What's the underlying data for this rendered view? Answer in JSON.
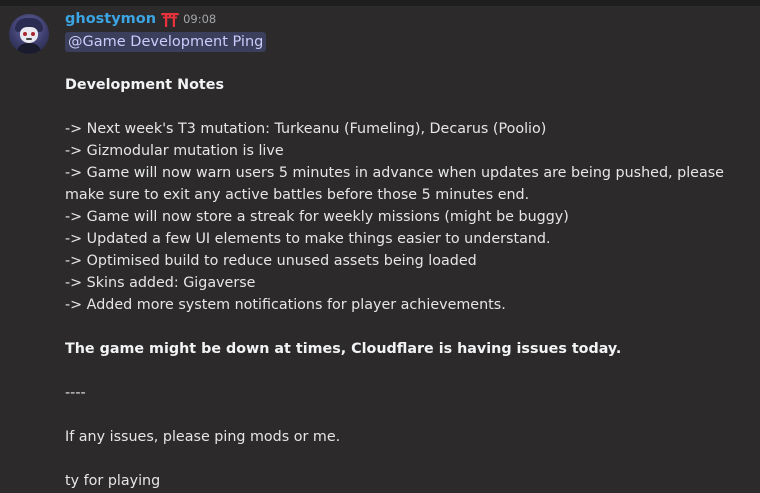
{
  "message": {
    "author": "ghostymon",
    "role_icon": "torii-gate-icon",
    "timestamp": "09:08",
    "mention": "@Game Development Ping",
    "heading": "Development Notes",
    "notes": [
      "-> Next week's T3 mutation: Turkeanu (Fumeling), Decarus (Poolio)",
      "-> Gizmodular mutation is live",
      "-> Game will now warn users 5 minutes in advance when updates are being pushed, please make sure to exit any active battles before those 5 minutes end.",
      "-> Game will now store a streak for weekly missions (might be buggy)",
      "-> Updated a few UI elements to make things easier to understand.",
      "-> Optimised build to reduce unused assets being loaded",
      "-> Skins added: Gigaverse",
      "-> Added more system notifications for player achievements."
    ],
    "warning": "The game might be down at times, Cloudflare is having issues today.",
    "separator": "----",
    "ping_note": "If any issues, please ping mods or me.",
    "closing": "ty for playing"
  },
  "colors": {
    "background": "#2c2a2a",
    "username": "#3ba4e3",
    "mention_bg": "#3b3f5c",
    "mention_text": "#c9cdfb",
    "role_icon": "#e8323c"
  }
}
